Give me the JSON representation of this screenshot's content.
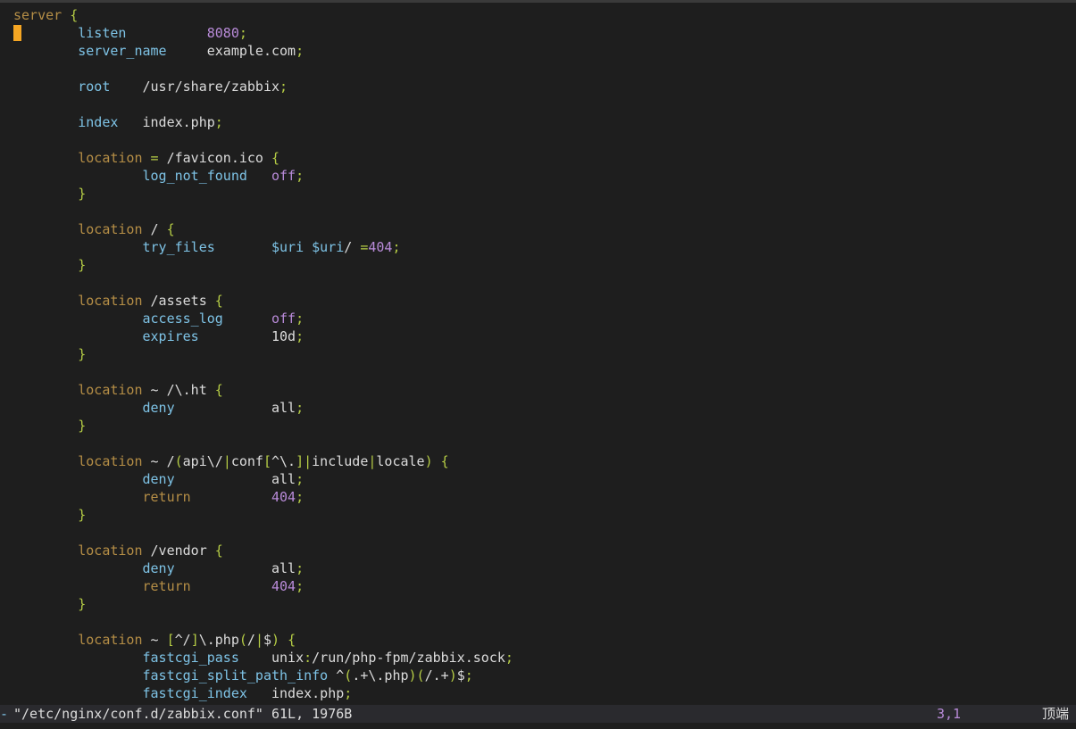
{
  "editor": {
    "cursor_line": 2,
    "lines": [
      [
        [
          "kw",
          "server"
        ],
        [
          "txt",
          " "
        ],
        [
          "brace",
          "{"
        ]
      ],
      [
        [
          "txt",
          "        "
        ],
        [
          "dir",
          "listen"
        ],
        [
          "txt",
          "          "
        ],
        [
          "num",
          "8080"
        ],
        [
          "brace",
          ";"
        ]
      ],
      [
        [
          "txt",
          "        "
        ],
        [
          "dir",
          "server_name"
        ],
        [
          "txt",
          "     example.com"
        ],
        [
          "brace",
          ";"
        ]
      ],
      [],
      [
        [
          "txt",
          "        "
        ],
        [
          "dir",
          "root"
        ],
        [
          "txt",
          "    /usr/share/zabbix"
        ],
        [
          "brace",
          ";"
        ]
      ],
      [],
      [
        [
          "txt",
          "        "
        ],
        [
          "dir",
          "index"
        ],
        [
          "txt",
          "   index.php"
        ],
        [
          "brace",
          ";"
        ]
      ],
      [],
      [
        [
          "txt",
          "        "
        ],
        [
          "kw",
          "location"
        ],
        [
          "txt",
          " "
        ],
        [
          "op",
          "="
        ],
        [
          "txt",
          " /favicon.ico "
        ],
        [
          "brace",
          "{"
        ]
      ],
      [
        [
          "txt",
          "                "
        ],
        [
          "dir",
          "log_not_found"
        ],
        [
          "txt",
          "   "
        ],
        [
          "num",
          "off"
        ],
        [
          "brace",
          ";"
        ]
      ],
      [
        [
          "txt",
          "        "
        ],
        [
          "brace",
          "}"
        ]
      ],
      [],
      [
        [
          "txt",
          "        "
        ],
        [
          "kw",
          "location"
        ],
        [
          "txt",
          " / "
        ],
        [
          "brace",
          "{"
        ]
      ],
      [
        [
          "txt",
          "                "
        ],
        [
          "dir",
          "try_files"
        ],
        [
          "txt",
          "       "
        ],
        [
          "var",
          "$uri"
        ],
        [
          "txt",
          " "
        ],
        [
          "var",
          "$uri"
        ],
        [
          "txt",
          "/ "
        ],
        [
          "op",
          "="
        ],
        [
          "num",
          "404"
        ],
        [
          "brace",
          ";"
        ]
      ],
      [
        [
          "txt",
          "        "
        ],
        [
          "brace",
          "}"
        ]
      ],
      [],
      [
        [
          "txt",
          "        "
        ],
        [
          "kw",
          "location"
        ],
        [
          "txt",
          " /assets "
        ],
        [
          "brace",
          "{"
        ]
      ],
      [
        [
          "txt",
          "                "
        ],
        [
          "dir",
          "access_log"
        ],
        [
          "txt",
          "      "
        ],
        [
          "num",
          "off"
        ],
        [
          "brace",
          ";"
        ]
      ],
      [
        [
          "txt",
          "                "
        ],
        [
          "dir",
          "expires"
        ],
        [
          "txt",
          "         10d"
        ],
        [
          "brace",
          ";"
        ]
      ],
      [
        [
          "txt",
          "        "
        ],
        [
          "brace",
          "}"
        ]
      ],
      [],
      [
        [
          "txt",
          "        "
        ],
        [
          "kw",
          "location"
        ],
        [
          "txt",
          " ~ /\\.ht "
        ],
        [
          "brace",
          "{"
        ]
      ],
      [
        [
          "txt",
          "                "
        ],
        [
          "dir",
          "deny"
        ],
        [
          "txt",
          "            all"
        ],
        [
          "brace",
          ";"
        ]
      ],
      [
        [
          "txt",
          "        "
        ],
        [
          "brace",
          "}"
        ]
      ],
      [],
      [
        [
          "txt",
          "        "
        ],
        [
          "kw",
          "location"
        ],
        [
          "txt",
          " ~ /"
        ],
        [
          "op",
          "("
        ],
        [
          "txt",
          "api\\/"
        ],
        [
          "op",
          "|"
        ],
        [
          "txt",
          "conf"
        ],
        [
          "op",
          "["
        ],
        [
          "txt",
          "^\\."
        ],
        [
          "op",
          "]|"
        ],
        [
          "txt",
          "include"
        ],
        [
          "op",
          "|"
        ],
        [
          "txt",
          "locale"
        ],
        [
          "op",
          ")"
        ],
        [
          "txt",
          " "
        ],
        [
          "brace",
          "{"
        ]
      ],
      [
        [
          "txt",
          "                "
        ],
        [
          "dir",
          "deny"
        ],
        [
          "txt",
          "            all"
        ],
        [
          "brace",
          ";"
        ]
      ],
      [
        [
          "txt",
          "                "
        ],
        [
          "kw",
          "return"
        ],
        [
          "txt",
          "          "
        ],
        [
          "num",
          "404"
        ],
        [
          "brace",
          ";"
        ]
      ],
      [
        [
          "txt",
          "        "
        ],
        [
          "brace",
          "}"
        ]
      ],
      [],
      [
        [
          "txt",
          "        "
        ],
        [
          "kw",
          "location"
        ],
        [
          "txt",
          " /vendor "
        ],
        [
          "brace",
          "{"
        ]
      ],
      [
        [
          "txt",
          "                "
        ],
        [
          "dir",
          "deny"
        ],
        [
          "txt",
          "            all"
        ],
        [
          "brace",
          ";"
        ]
      ],
      [
        [
          "txt",
          "                "
        ],
        [
          "kw",
          "return"
        ],
        [
          "txt",
          "          "
        ],
        [
          "num",
          "404"
        ],
        [
          "brace",
          ";"
        ]
      ],
      [
        [
          "txt",
          "        "
        ],
        [
          "brace",
          "}"
        ]
      ],
      [],
      [
        [
          "txt",
          "        "
        ],
        [
          "kw",
          "location"
        ],
        [
          "txt",
          " ~ "
        ],
        [
          "op",
          "["
        ],
        [
          "txt",
          "^/"
        ],
        [
          "op",
          "]"
        ],
        [
          "txt",
          "\\.php"
        ],
        [
          "op",
          "("
        ],
        [
          "txt",
          "/"
        ],
        [
          "op",
          "|"
        ],
        [
          "txt",
          "$"
        ],
        [
          "op",
          ")"
        ],
        [
          "txt",
          " "
        ],
        [
          "brace",
          "{"
        ]
      ],
      [
        [
          "txt",
          "                "
        ],
        [
          "dir",
          "fastcgi_pass"
        ],
        [
          "txt",
          "    unix"
        ],
        [
          "op",
          ":"
        ],
        [
          "txt",
          "/run/php-fpm/zabbix.sock"
        ],
        [
          "brace",
          ";"
        ]
      ],
      [
        [
          "txt",
          "                "
        ],
        [
          "dir",
          "fastcgi_split_path_info"
        ],
        [
          "txt",
          " ^"
        ],
        [
          "op",
          "("
        ],
        [
          "txt",
          ".+\\.php"
        ],
        [
          "op",
          ")("
        ],
        [
          "txt",
          "/.+"
        ],
        [
          "op",
          ")"
        ],
        [
          "txt",
          "$"
        ],
        [
          "brace",
          ";"
        ]
      ],
      [
        [
          "txt",
          "                "
        ],
        [
          "dir",
          "fastcgi_index"
        ],
        [
          "txt",
          "   index.php"
        ],
        [
          "brace",
          ";"
        ]
      ]
    ]
  },
  "status": {
    "left_mark": "-",
    "message": "\"/etc/nginx/conf.d/zabbix.conf\" 61L, 1976B",
    "position": "3,1",
    "scroll": "顶端"
  },
  "colors": {
    "background": "#1e1e1e",
    "cursor": "#f5a623",
    "keyword": "#b58e46",
    "directive": "#7ec3e6",
    "brace": "#b5cc45",
    "number": "#b98bd9"
  }
}
